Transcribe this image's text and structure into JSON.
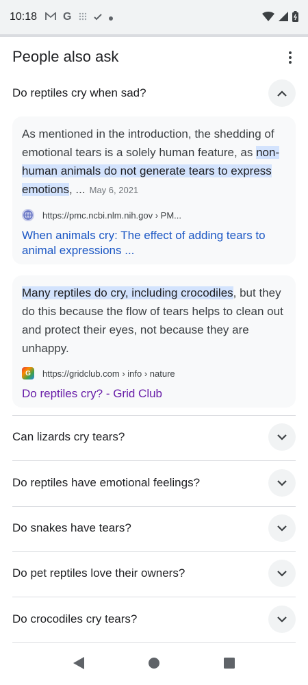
{
  "status_bar": {
    "time": "10:18",
    "icons": [
      "gmail-icon",
      "google-icon",
      "grid-icon",
      "check-icon",
      "dot-icon"
    ],
    "right_icons": [
      "wifi-icon",
      "signal-icon",
      "battery-icon"
    ]
  },
  "paa": {
    "title": "People also ask",
    "expanded_question": "Do reptiles cry when sad?",
    "answers": [
      {
        "pre_text": "As mentioned in the introduction, the shedding of emotional tears is a solely human feature, as ",
        "highlight": "non-human animals do not generate tears to express emotions",
        "post_text": ", ...",
        "date": "May 6, 2021",
        "source_url": "https://pmc.ncbi.nlm.nih.gov › PM...",
        "link_text": "When animals cry: The effect of adding tears to animal expressions ...",
        "link_color": "#1a56c4"
      },
      {
        "highlight": "Many reptiles do cry, including crocodiles",
        "post_text": ", but they do this because the flow of tears helps to clean out and protect their eyes, not because they are unhappy.",
        "source_url": "https://gridclub.com › info › nature",
        "link_text": "Do reptiles cry? - Grid Club",
        "link_color": "#681da8"
      }
    ],
    "collapsed_questions": [
      "Can lizards cry tears?",
      "Do reptiles have emotional feelings?",
      "Do snakes have tears?",
      "Do pet reptiles love their owners?",
      "Do crocodiles cry tears?"
    ]
  },
  "nav": {
    "icons": [
      "back-icon",
      "home-icon",
      "recents-icon"
    ]
  }
}
